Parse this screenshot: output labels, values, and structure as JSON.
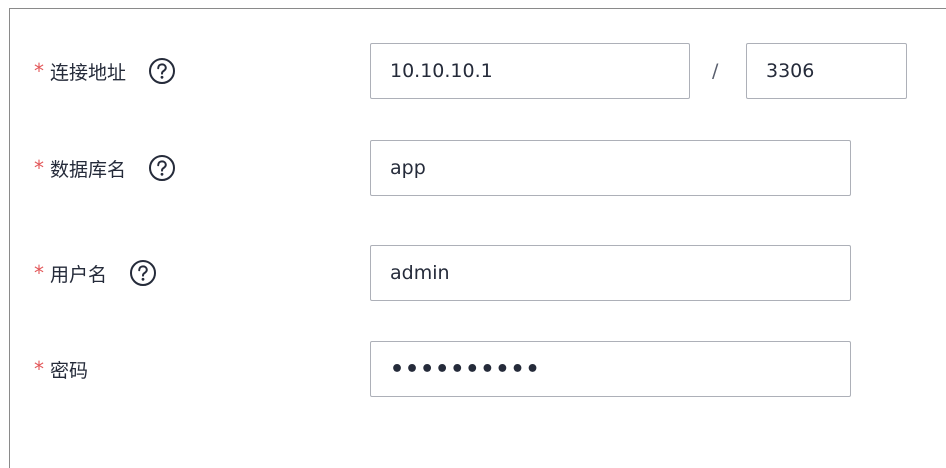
{
  "form": {
    "connection": {
      "required_mark": "*",
      "label": "连接地址",
      "help_icon": "question-circle-icon",
      "host_value": "10.10.10.1",
      "separator": "/",
      "port_value": "3306"
    },
    "database": {
      "required_mark": "*",
      "label": "数据库名",
      "help_icon": "question-circle-icon",
      "value": "app"
    },
    "username": {
      "required_mark": "*",
      "label": "用户名",
      "help_icon": "question-circle-icon",
      "value": "admin"
    },
    "password": {
      "required_mark": "*",
      "label": "密码",
      "value": "••••••••••"
    }
  },
  "colors": {
    "required_star": "#e25759",
    "input_border": "#adb0b8",
    "text": "#252b3a",
    "panel_border": "#8a8a8a"
  }
}
